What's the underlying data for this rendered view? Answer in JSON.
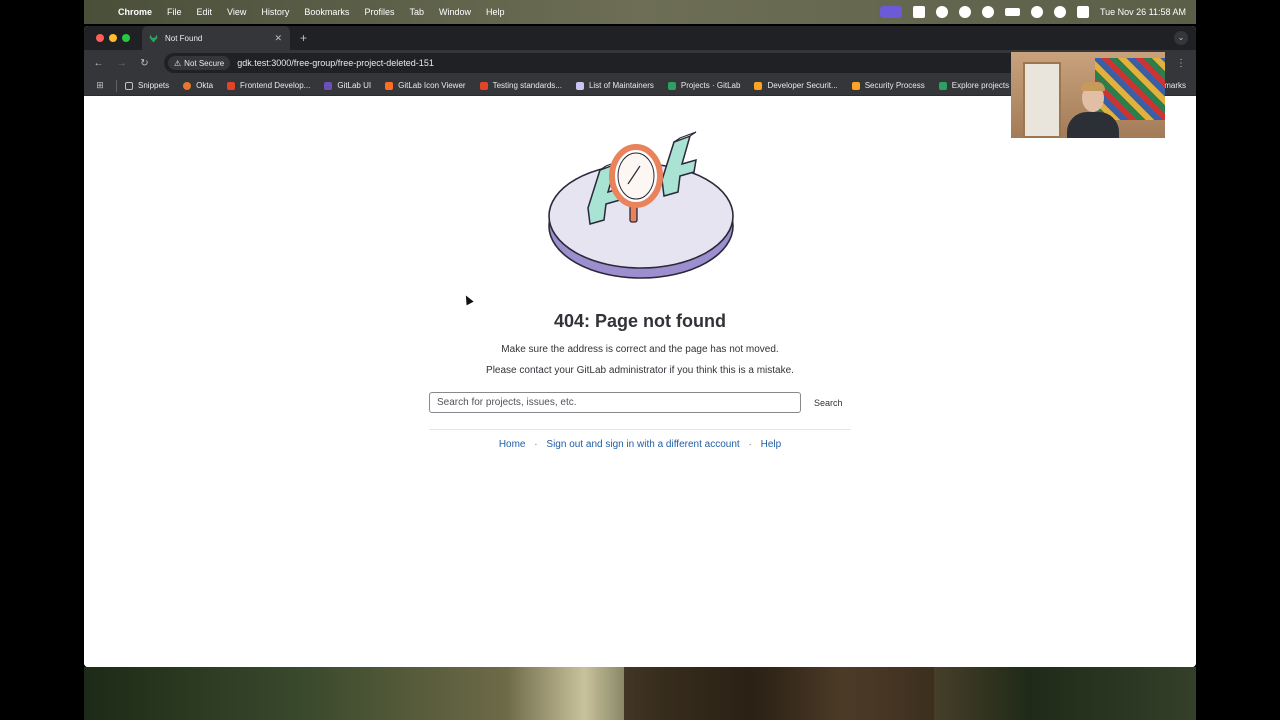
{
  "menubar": {
    "app": "Chrome",
    "items": [
      "File",
      "Edit",
      "View",
      "History",
      "Bookmarks",
      "Profiles",
      "Tab",
      "Window",
      "Help"
    ],
    "clock": "Tue Nov 26  11:58 AM"
  },
  "tab": {
    "title": "Not Found"
  },
  "toolbar": {
    "security_label": "Not Secure",
    "url": "gdk.test:3000/free-group/free-project-deleted-151"
  },
  "bookmarks": {
    "items": [
      {
        "label": "Snippets",
        "color": "#bdc1c6"
      },
      {
        "label": "Okta",
        "color": "#e8772e"
      },
      {
        "label": "Frontend Develop...",
        "color": "#e24329"
      },
      {
        "label": "GitLab UI",
        "color": "#6b4fbb"
      },
      {
        "label": "GitLab Icon Viewer",
        "color": "#fc6d26"
      },
      {
        "label": "Testing standards...",
        "color": "#e24329"
      },
      {
        "label": "List of Maintainers",
        "color": "#c9c4f2"
      },
      {
        "label": "Projects · GitLab",
        "color": "#2da160"
      },
      {
        "label": "Developer Securit...",
        "color": "#fca326"
      },
      {
        "label": "Security Process",
        "color": "#fca326"
      },
      {
        "label": "Explore projects",
        "color": "#2da160"
      }
    ],
    "more": "marks"
  },
  "page": {
    "title": "404: Page not found",
    "message_1": "Make sure the address is correct and the page has not moved.",
    "message_2": "Please contact your GitLab administrator if you think this is a mistake.",
    "search_placeholder": "Search for projects, issues, etc.",
    "search_button": "Search",
    "links": {
      "home": "Home",
      "sign_out": "Sign out and sign in with a different account",
      "help": "Help",
      "separator": "·"
    }
  },
  "colors": {
    "link": "#1f5ea6",
    "heading": "#333238",
    "illustration_teal": "#a8e3d4",
    "illustration_orange": "#e9835c",
    "illustration_platform": "#e7e4f2",
    "illustration_platform_edge": "#9d8fcf"
  }
}
